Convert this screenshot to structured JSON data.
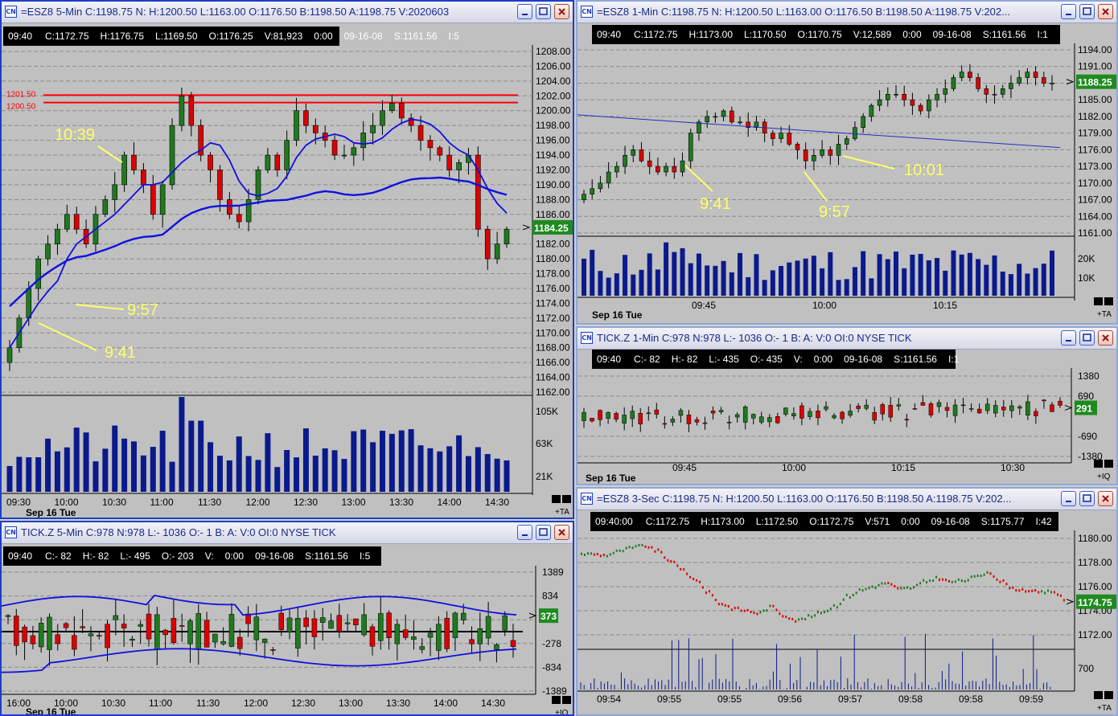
{
  "windows": {
    "es5": {
      "title": "=ESZ8 5-Min C:1198.75 N: H:1200.50 L:1163.00 O:1176.50 B:1198.50 A:1198.75 V:2020603",
      "info": [
        "09:40",
        "C:1172.75",
        "H:1176.75",
        "L:1169.50",
        "O:1176.25",
        "V:81,923",
        "0:00",
        "09-16-08",
        "S:1161.56",
        "I:5"
      ],
      "last_price": "1184.25",
      "price_ticks": [
        "1208.00",
        "1206.00",
        "1204.00",
        "1202.00",
        "1200.00",
        "1198.00",
        "1196.00",
        "1194.00",
        "1192.00",
        "1190.00",
        "1188.00",
        "1186.00",
        "1184.00",
        "1182.00",
        "1180.00",
        "1178.00",
        "1176.00",
        "1174.00",
        "1172.00",
        "1170.00",
        "1168.00",
        "1166.00",
        "1164.00",
        "1162.00"
      ],
      "volume_ticks": [
        "105K",
        "63K",
        "21K"
      ],
      "time_ticks": [
        "09:30",
        "10:00",
        "10:30",
        "11:00",
        "11:30",
        "12:00",
        "12:30",
        "13:00",
        "13:30",
        "14:00",
        "14:30"
      ],
      "date_label": "Sep 16 Tue",
      "level_labels": [
        "1201.50",
        "1200.50"
      ],
      "annotations": [
        "10:39",
        "9:57",
        "9:41"
      ],
      "corner_tag": "+TA"
    },
    "es1": {
      "title": "=ESZ8 1-Min C:1198.75 N: H:1200.50 L:1163.00 O:1176.50 B:1198.50 A:1198.75 V:202...",
      "info": [
        "09:40",
        "C:1172.75",
        "H:1173.00",
        "L:1170.50",
        "O:1170.75",
        "V:12,589",
        "0:00",
        "09-16-08",
        "S:1161.56",
        "I:1"
      ],
      "last_price": "1188.25",
      "price_ticks": [
        "1194.00",
        "1191.00",
        "1188.00",
        "1185.00",
        "1182.00",
        "1179.00",
        "1176.00",
        "1173.00",
        "1170.00",
        "1167.00",
        "1164.00",
        "1161.00"
      ],
      "volume_ticks": [
        "20K",
        "10K"
      ],
      "time_ticks": [
        "09:45",
        "10:00",
        "10:15"
      ],
      "date_label": "Sep 16 Tue",
      "annotations": [
        "9:41",
        "9:57",
        "10:01"
      ],
      "corner_tag": "+TA"
    },
    "tick1": {
      "title": "TICK.Z 1-Min C:978 N:978 L:- 1036 O:- 1 B: A: V:0 OI:0 NYSE TICK",
      "info": [
        "09:40",
        "C:- 82",
        "H:- 82",
        "L:- 435",
        "O:- 435",
        "V:",
        "0:00",
        "09-16-08",
        "S:1161.56",
        "I:1"
      ],
      "last_price": "291",
      "value_ticks": [
        "1380",
        "690",
        "-690",
        "-1380"
      ],
      "time_ticks": [
        "09:45",
        "10:00",
        "10:15",
        "10:30"
      ],
      "date_label": "Sep 16 Tue",
      "corner_tag": "+IQ"
    },
    "tick5": {
      "title": "TICK.Z 5-Min C:978 N:978 L:- 1036 O:- 1 B: A: V:0 OI:0 NYSE TICK",
      "info": [
        "09:40",
        "C:- 82",
        "H:- 82",
        "L:- 495",
        "O:- 203",
        "V:",
        "0:00",
        "09-16-08",
        "S:1161.56",
        "I:5"
      ],
      "last_price": "373",
      "value_ticks": [
        "1389",
        "834",
        "278",
        "-278",
        "-834",
        "-1389"
      ],
      "time_ticks": [
        "16:00",
        "10:00",
        "10:30",
        "11:00",
        "11:30",
        "12:00",
        "12:30",
        "13:00",
        "13:30",
        "14:00",
        "14:30"
      ],
      "date_label": "Sep 16 Tue",
      "corner_tag": "+IQ"
    },
    "es3s": {
      "title": "=ESZ8 3-Sec C:1198.75 N: H:1200.50 L:1163.00 O:1176.50 B:1198.50 A:1198.75 V:202...",
      "info": [
        "09:40:00",
        "C:1172.75",
        "H:1173.00",
        "L:1172.50",
        "O:1172.75",
        "V:571",
        "0:00",
        "09-16-08",
        "S:1175.77",
        "I:42"
      ],
      "last_price": "1174.75",
      "price_ticks": [
        "1180.00",
        "1178.00",
        "1176.00",
        "1174.00",
        "1172.00"
      ],
      "volume_ticks": [
        "700"
      ],
      "time_ticks": [
        "09:54",
        "09:55",
        "09:55",
        "09:56",
        "09:57",
        "09:58",
        "09:58",
        "09:59"
      ],
      "date_label": "",
      "corner_tag": "+TA"
    }
  },
  "colors": {
    "up": "#1f7a1f",
    "down": "#dd0000",
    "volume": "#0a1a8c",
    "ma": "#1010e0",
    "level": "#ff0000",
    "annotation": "#ffff66",
    "chart_bg": "#c0c0c0",
    "last_price_bg": "#1f8a1f"
  },
  "chart_data": [
    {
      "type": "candlestick",
      "title": "=ESZ8 5-Min",
      "x": [
        "09:30",
        "10:00",
        "10:30",
        "11:00",
        "11:30",
        "12:00",
        "12:30",
        "13:00",
        "13:30",
        "14:00",
        "14:30"
      ],
      "close": [
        1168,
        1172,
        1176,
        1182,
        1184,
        1190,
        1192,
        1202,
        1200,
        1196,
        1194,
        1196,
        1198,
        1194,
        1186,
        1184,
        1188,
        1192,
        1196,
        1200,
        1200,
        1196,
        1196,
        1198,
        1200,
        1202,
        1198,
        1196,
        1194,
        1193,
        1184,
        1180,
        1184
      ],
      "levels": [
        1201.5,
        1200.5
      ],
      "ylim": [
        1162,
        1209
      ]
    },
    {
      "type": "candlestick",
      "title": "=ESZ8 1-Min",
      "x": [
        "09:45",
        "10:00",
        "10:15"
      ],
      "ylim": [
        1160,
        1195
      ],
      "last": 1188.25
    },
    {
      "type": "bar",
      "title": "TICK.Z 1-Min",
      "x": [
        "09:45",
        "10:00",
        "10:15",
        "10:30"
      ],
      "ylim": [
        -1380,
        1380
      ],
      "last": 291
    },
    {
      "type": "bar",
      "title": "TICK.Z 5-Min",
      "x": [
        "16:00",
        "10:00",
        "10:30",
        "11:00",
        "11:30",
        "12:00",
        "12:30",
        "13:00",
        "13:30",
        "14:00",
        "14:30"
      ],
      "ylim": [
        -1389,
        1389
      ],
      "last": 373
    },
    {
      "type": "bar",
      "title": "=ESZ8 3-Sec",
      "x": [
        "09:54",
        "09:55",
        "09:55",
        "09:56",
        "09:57",
        "09:58",
        "09:58",
        "09:59"
      ],
      "ylim": [
        1171,
        1181
      ],
      "last": 1174.75
    }
  ]
}
